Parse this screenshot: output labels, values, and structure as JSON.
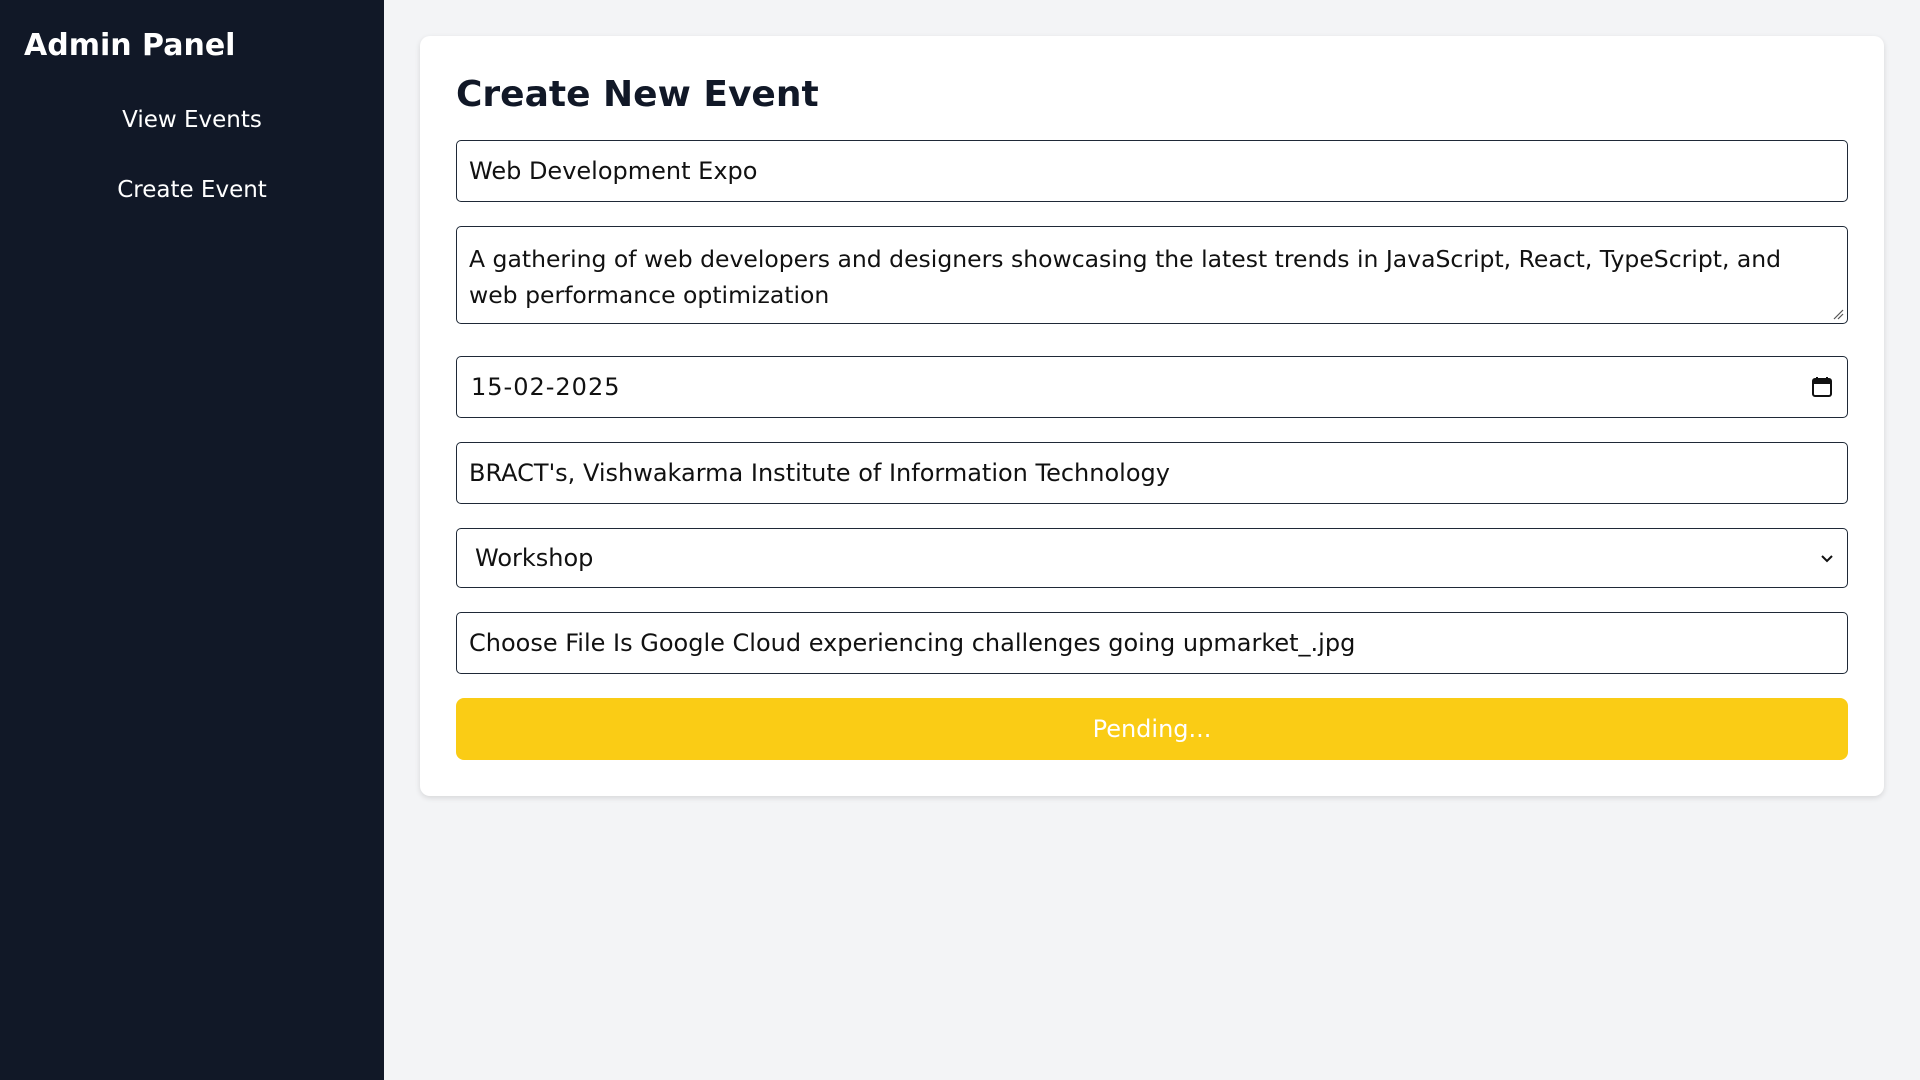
{
  "sidebar": {
    "title": "Admin Panel",
    "items": [
      {
        "label": "View Events"
      },
      {
        "label": "Create Event"
      }
    ]
  },
  "form": {
    "heading": "Create New Event",
    "title_value": "Web Development Expo",
    "description_value": "A gathering of web developers and designers showcasing the latest trends in JavaScript, React, TypeScript, and web performance optimization",
    "date_value": "15-02-2025",
    "location_value": "BRACT's, Vishwakarma Institute of Information Technology",
    "category_selected": "Workshop",
    "file_button_label": "Choose File",
    "file_name": "Is Google Cloud experiencing challenges going upmarket_.jpg",
    "submit_label": "Pending..."
  },
  "icons": {
    "date": "calendar-icon",
    "select": "chevron-down-icon",
    "resize": "resize-grip-icon"
  },
  "colors": {
    "sidebar_bg": "#111827",
    "page_bg": "#f3f4f6",
    "submit_bg": "#facc15"
  }
}
